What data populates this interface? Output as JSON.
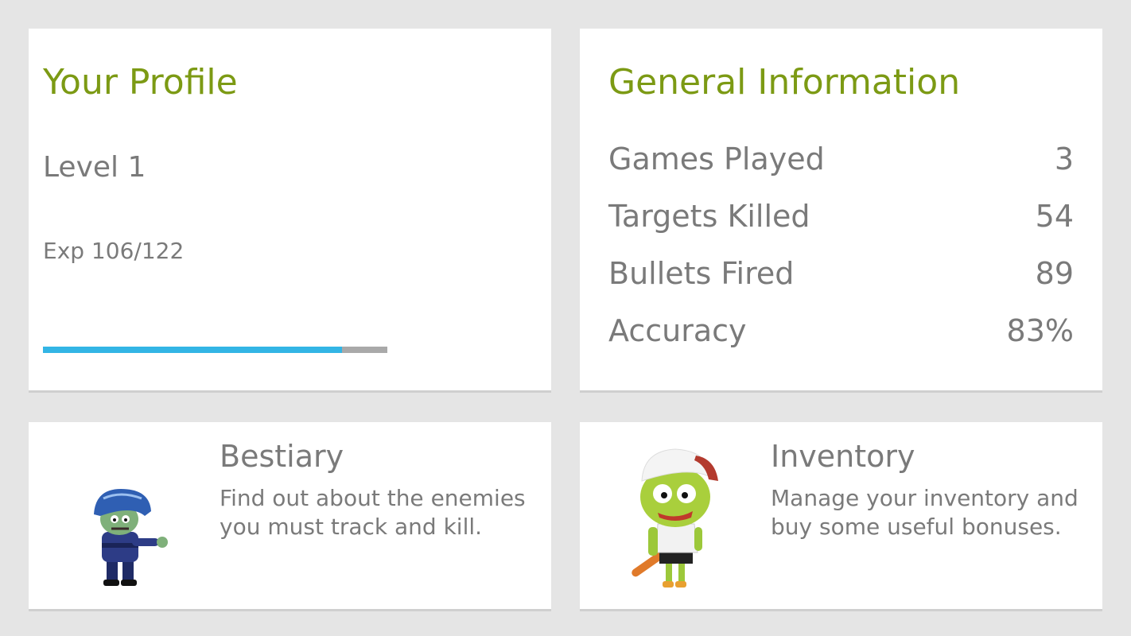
{
  "profile": {
    "title": "Your Profile",
    "level": "Level 1",
    "exp_text": "Exp 106/122",
    "exp_current": 106,
    "exp_max": 122,
    "bar_color": "#33b5e5",
    "title_color": "#7c9a14"
  },
  "info": {
    "title": "General Information",
    "stats": [
      {
        "label": "Games Played",
        "value": "3"
      },
      {
        "label": "Targets Killed",
        "value": "54"
      },
      {
        "label": "Bullets Fired",
        "value": "89"
      },
      {
        "label": "Accuracy",
        "value": "83%"
      }
    ]
  },
  "bestiary": {
    "title": "Bestiary",
    "description": "Find out about the enemies you must track and kill.",
    "icon": "riot-zombie-icon"
  },
  "inventory": {
    "title": "Inventory",
    "description": "Manage your inventory and buy some useful bonuses.",
    "icon": "cap-zombie-icon"
  }
}
